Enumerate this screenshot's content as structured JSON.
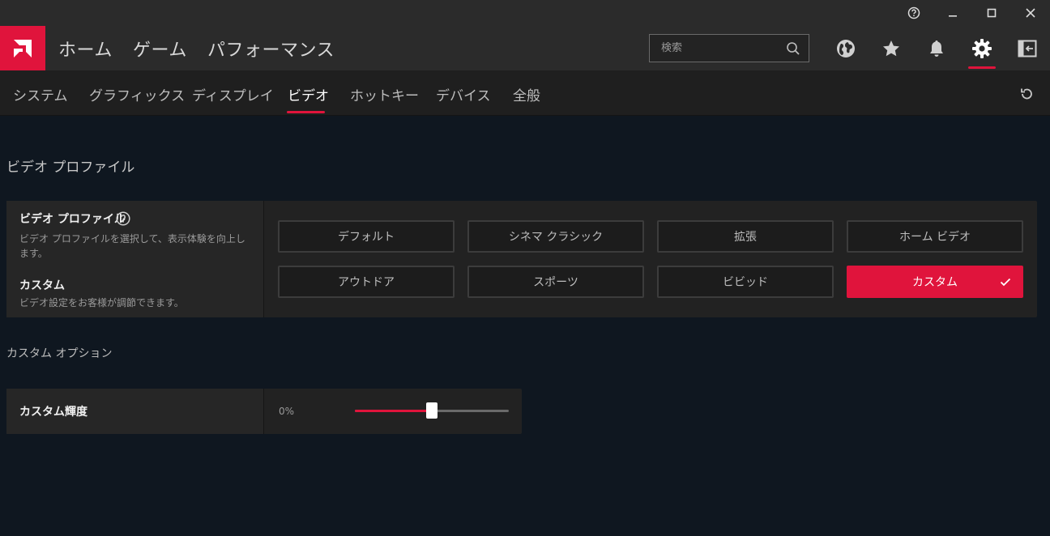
{
  "titlebar": {
    "icons": [
      "help-icon",
      "minimize-icon",
      "maximize-icon",
      "close-icon"
    ]
  },
  "topnav": {
    "logo": "amd-logo",
    "items": [
      "ホーム",
      "ゲーム",
      "パフォーマンス"
    ],
    "search_placeholder": "検索",
    "icons": [
      "globe-icon",
      "star-icon",
      "bell-icon",
      "gear-icon",
      "sidebar-icon"
    ],
    "active_icon": "gear-icon"
  },
  "subnav": {
    "tabs": [
      "システム",
      "グラフィックス",
      "ディスプレイ",
      "ビデオ",
      "ホットキー",
      "デバイス",
      "全般"
    ],
    "active": "ビデオ"
  },
  "main": {
    "section_title": "ビデオ プロファイル",
    "profile": {
      "title": "ビデオ プロファイル",
      "description": "ビデオ プロファイルを選択して、表示体験を向上します。",
      "custom_title": "カスタム",
      "custom_description": "ビデオ設定をお客様が調節できます。",
      "options": [
        "デフォルト",
        "シネマ クラシック",
        "拡張",
        "ホーム ビデオ",
        "アウトドア",
        "スポーツ",
        "ビビッド",
        "カスタム"
      ],
      "selected": "カスタム"
    },
    "custom_options_title": "カスタム オプション",
    "brightness": {
      "label": "カスタム輝度",
      "value_text": "0%",
      "slider_fraction": 0.5
    }
  },
  "colors": {
    "accent": "#e0143c",
    "background": "#0f1720",
    "panel": "#222222"
  }
}
